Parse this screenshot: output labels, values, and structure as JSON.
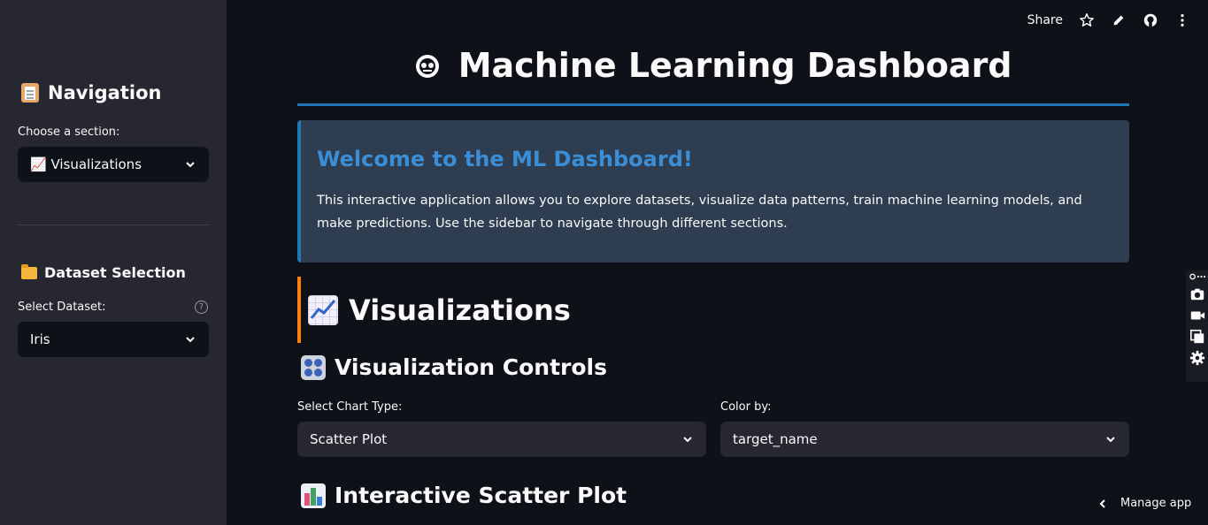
{
  "sidebar": {
    "nav_title": "Navigation",
    "section_label": "Choose a section:",
    "section_value": "📈 Visualizations",
    "dataset_title": "Dataset Selection",
    "dataset_label": "Select Dataset:",
    "dataset_value": "Iris",
    "help": "?"
  },
  "toolbar": {
    "share": "Share"
  },
  "main": {
    "title": "Machine Learning Dashboard",
    "welcome_title": "Welcome to the ML Dashboard!",
    "welcome_text": "This interactive application allows you to explore datasets, visualize data patterns, train machine learning models, and make predictions. Use the sidebar to navigate through different sections.",
    "section_title": "Visualizations",
    "controls_title": "Visualization Controls",
    "chart_type_label": "Select Chart Type:",
    "chart_type_value": "Scatter Plot",
    "color_by_label": "Color by:",
    "color_by_value": "target_name",
    "plot_title": "Interactive Scatter Plot"
  },
  "footer": {
    "manage": "Manage app"
  },
  "colors": {
    "accent_blue": "#1f77b4",
    "accent_orange": "#ff7f0e",
    "sidebar_bg": "#262730",
    "app_bg": "#0e1117"
  }
}
